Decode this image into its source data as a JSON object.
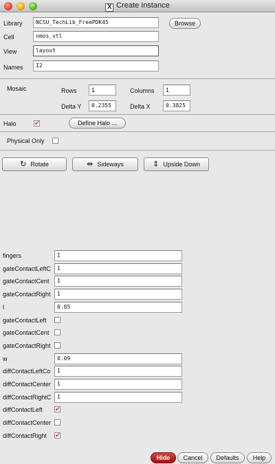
{
  "window": {
    "title": "Create Instance"
  },
  "library": {
    "label": "Library",
    "value": "NCSU_TechLib_FreePDK45",
    "browse_label": "Browse"
  },
  "cell": {
    "label": "Cell",
    "value": "nmos_vtl"
  },
  "view": {
    "label": "View",
    "value": "layout"
  },
  "names": {
    "label": "Names",
    "value": "I2"
  },
  "mosaic": {
    "label": "Mosaic",
    "rows_label": "Rows",
    "rows_value": "1",
    "columns_label": "Columns",
    "columns_value": "1",
    "delta_y_label": "Delta Y",
    "delta_y_value": "0.2355",
    "delta_x_label": "Delta X",
    "delta_x_value": "0.3825"
  },
  "halo": {
    "label": "Halo",
    "checked": true,
    "define_label": "Define Halo ..."
  },
  "physical_only": {
    "label": "Physical Only",
    "checked": false
  },
  "transform": {
    "rotate": "Rotate",
    "sideways": "Sideways",
    "upside_down": "Upside Down"
  },
  "params": [
    {
      "label": "fingers",
      "kind": "text",
      "value": "1"
    },
    {
      "label": "gateContactLeftC",
      "kind": "text",
      "value": "1"
    },
    {
      "label": "gateContactCent",
      "kind": "text",
      "value": "1"
    },
    {
      "label": "gateContactRight",
      "kind": "text",
      "value": "1"
    },
    {
      "label": "l",
      "kind": "text",
      "value": "0.05"
    },
    {
      "label": "gateContactLeft",
      "kind": "check",
      "checked": false
    },
    {
      "label": "gateContactCent",
      "kind": "check",
      "checked": false
    },
    {
      "label": "gateContactRight",
      "kind": "check",
      "checked": false
    },
    {
      "label": "w",
      "kind": "text",
      "value": "0.09"
    },
    {
      "label": "diffContactLeftCo",
      "kind": "text",
      "value": "1"
    },
    {
      "label": "diffContactCenter",
      "kind": "text",
      "value": "1"
    },
    {
      "label": "diffContactRightC",
      "kind": "text",
      "value": "1"
    },
    {
      "label": "diffContactLeft",
      "kind": "check",
      "checked": true
    },
    {
      "label": "diffContactCenter",
      "kind": "check",
      "checked": false
    },
    {
      "label": "diffContactRight",
      "kind": "check",
      "checked": true
    }
  ],
  "footer": {
    "hide": "Hide",
    "cancel": "Cancel",
    "defaults": "Defaults",
    "help": "Help"
  },
  "colors": {
    "accent_red": "#c51a1a",
    "hide_button": "#b01818"
  },
  "icons": {
    "check": "✔"
  }
}
